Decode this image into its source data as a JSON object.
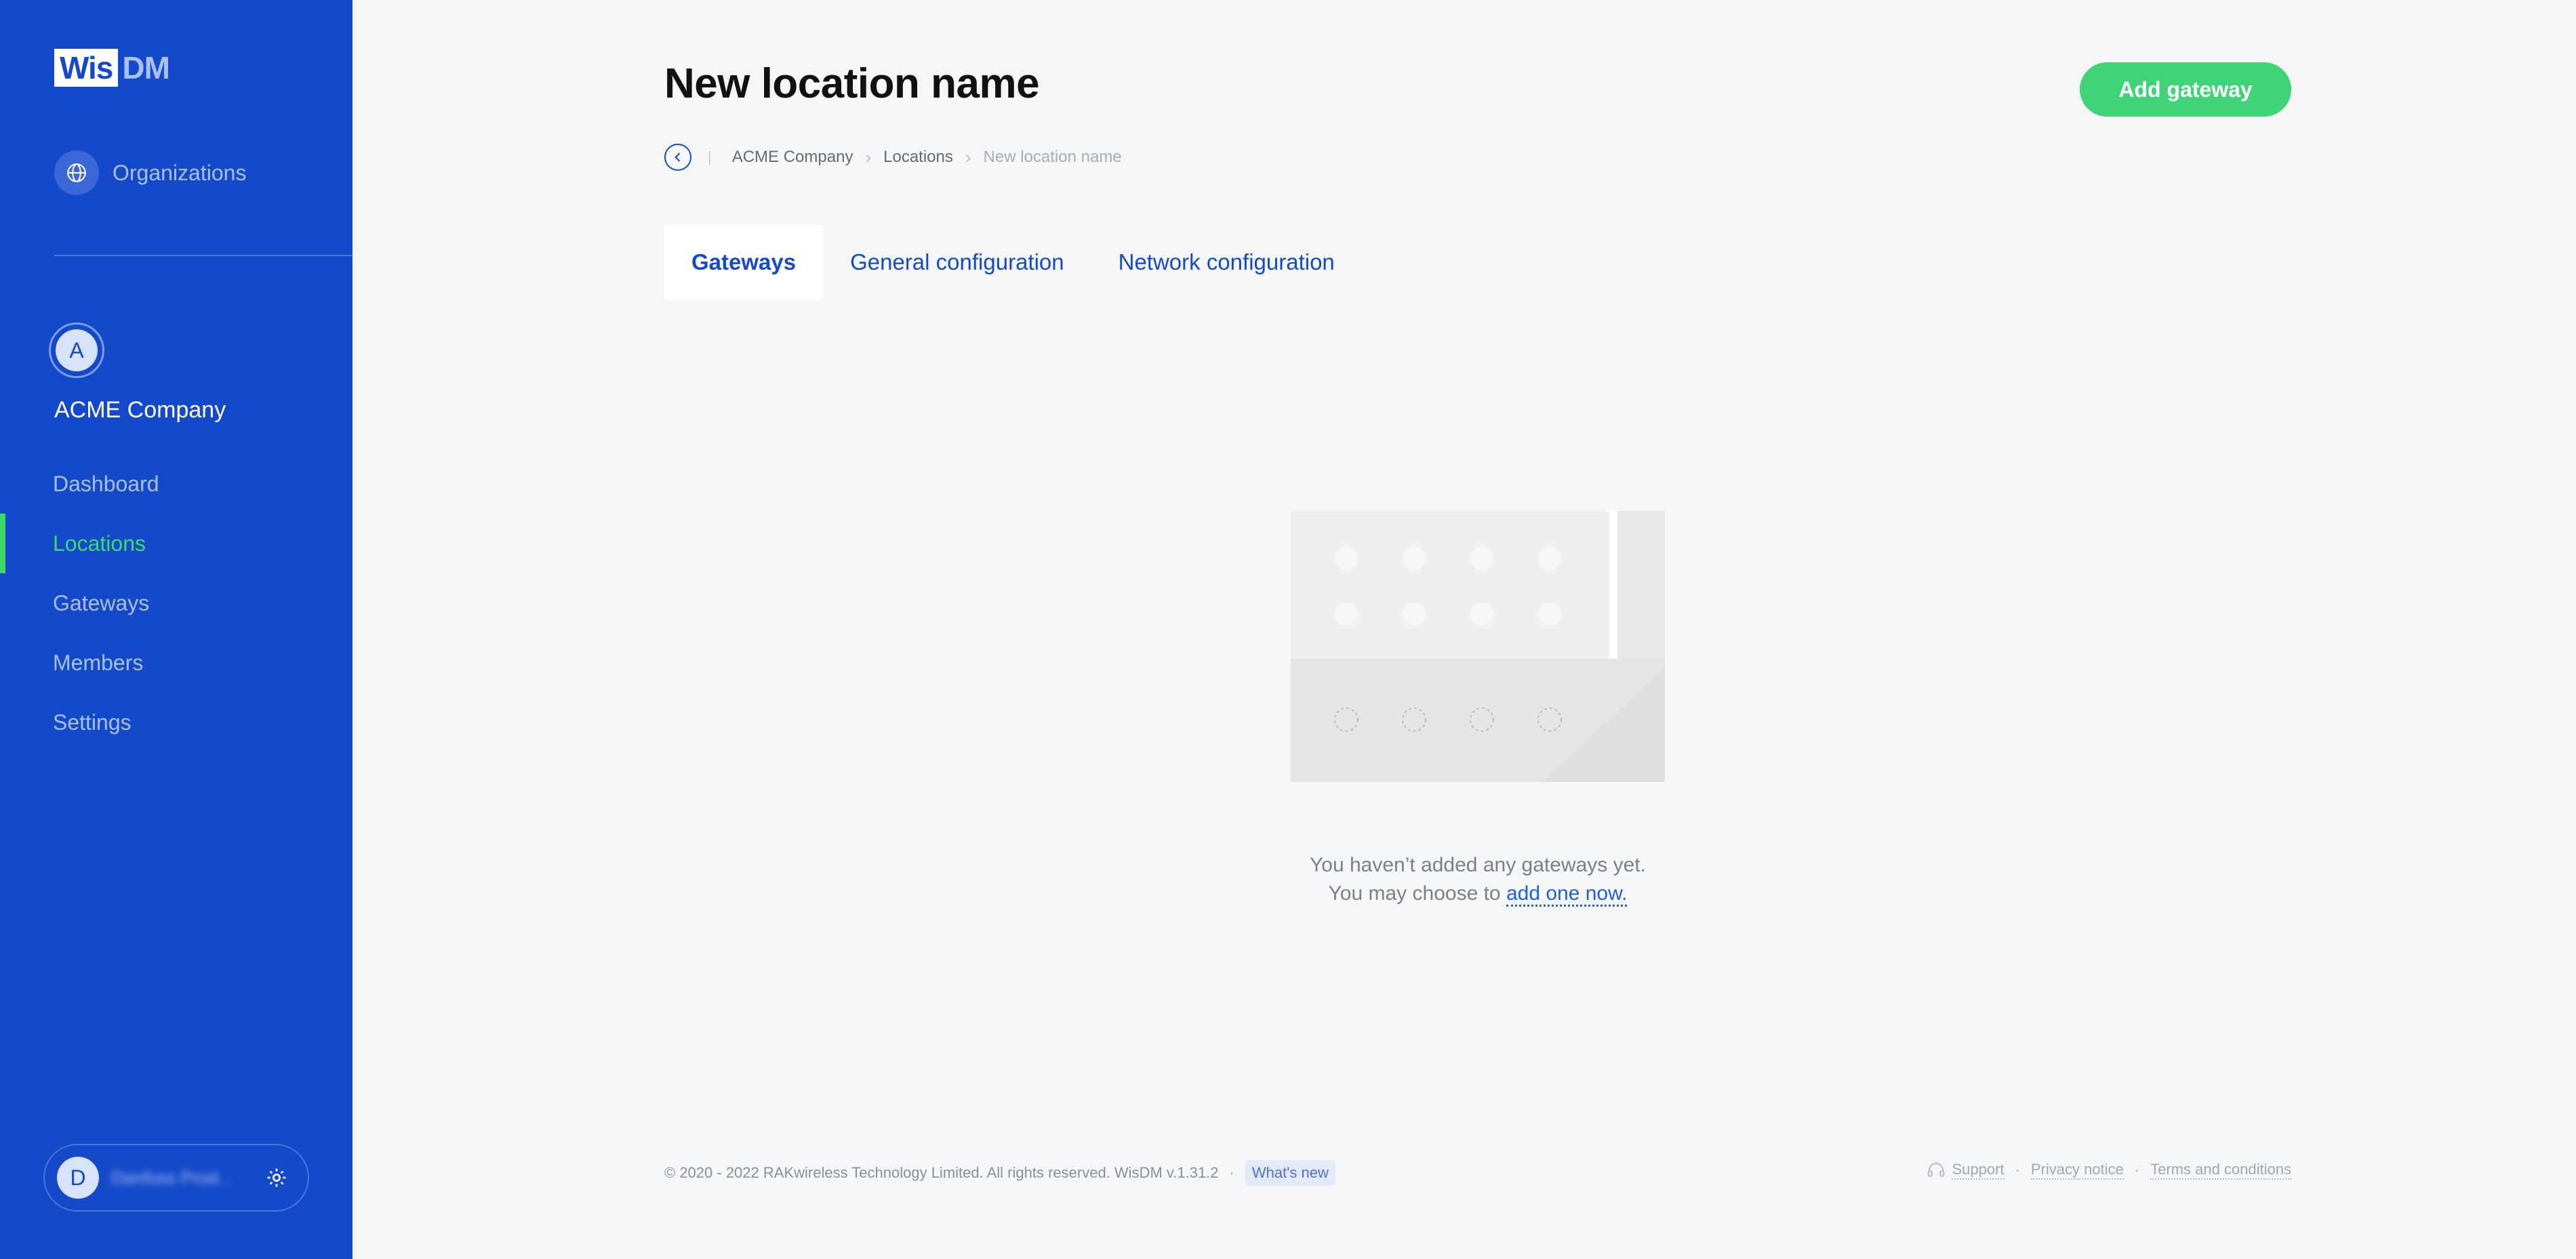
{
  "brand": {
    "logo_wis": "Wis",
    "logo_dm": "DM"
  },
  "sidebar": {
    "organizations_label": "Organizations",
    "company_initial": "A",
    "company_name": "ACME Company",
    "nav": [
      {
        "label": "Dashboard",
        "active": false
      },
      {
        "label": "Locations",
        "active": true
      },
      {
        "label": "Gateways",
        "active": false
      },
      {
        "label": "Members",
        "active": false
      },
      {
        "label": "Settings",
        "active": false
      }
    ],
    "user": {
      "initial": "D",
      "name": "Danfoss Prod..."
    }
  },
  "header": {
    "title": "New location name",
    "add_gateway_label": "Add gateway"
  },
  "breadcrumb": {
    "items": [
      "ACME Company",
      "Locations"
    ],
    "current": "New location name"
  },
  "tabs": [
    {
      "label": "Gateways",
      "active": true
    },
    {
      "label": "General configuration",
      "active": false
    },
    {
      "label": "Network configuration",
      "active": false
    }
  ],
  "empty_state": {
    "line1": "You haven’t added any gateways yet.",
    "line2_prefix": "You may choose to",
    "link": "add one now."
  },
  "footer": {
    "copyright": "© 2020 - 2022 RAKwireless Technology Limited. All rights reserved. WisDM v.1.31.2",
    "whats_new": "What's new",
    "support": "Support",
    "privacy": "Privacy notice",
    "terms": "Terms and conditions"
  },
  "colors": {
    "sidebar_bg": "#1449c9",
    "accent_green": "#3fd477",
    "page_bg": "#f5f6f8",
    "link_blue": "#1f5fd6"
  }
}
